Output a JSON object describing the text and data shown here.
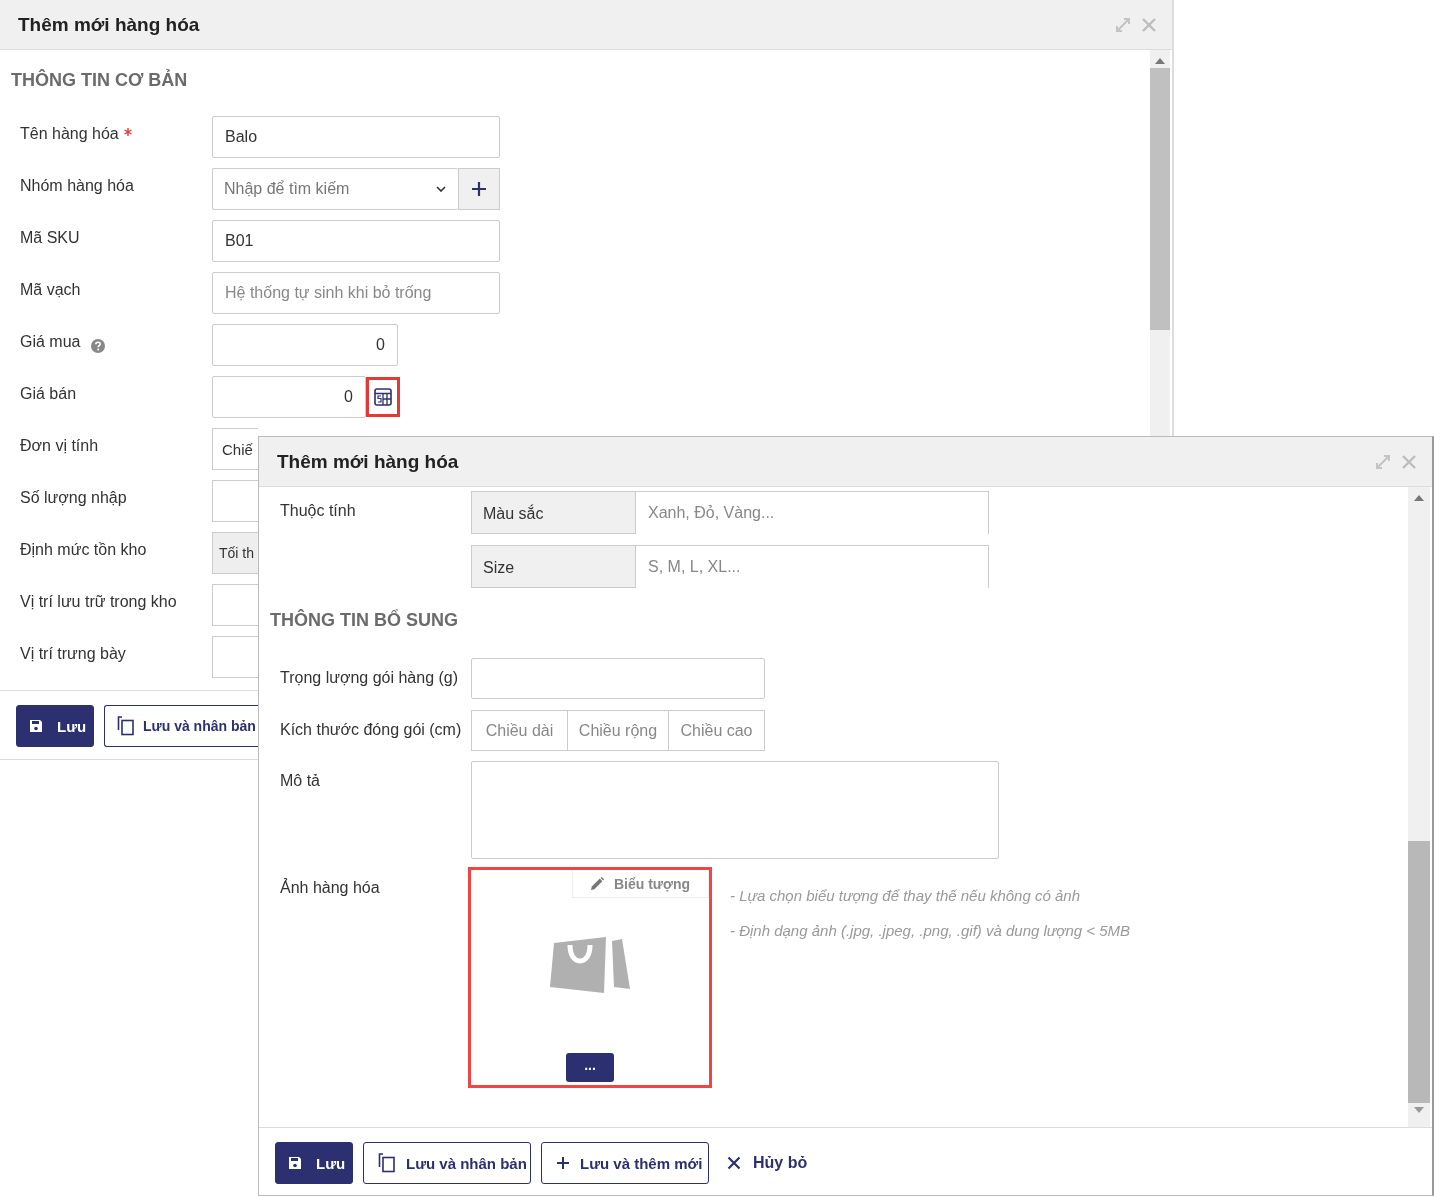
{
  "back_dialog": {
    "title": "Thêm mới hàng hóa",
    "section_title": "THÔNG TIN CƠ BẢN",
    "fields": [
      {
        "label": "Tên hàng hóa",
        "kind": "text",
        "value": "Balo",
        "required": true,
        "help": false
      },
      {
        "label": "Nhóm hàng hóa",
        "kind": "select-add",
        "placeholder": "Nhập để tìm kiếm",
        "required": false,
        "help": false
      },
      {
        "label": "Mã SKU",
        "kind": "text",
        "value": "B01",
        "required": false,
        "help": false
      },
      {
        "label": "Mã vạch",
        "kind": "text",
        "placeholder": "Hệ thống tự sinh khi bỏ trống",
        "required": false,
        "help": false
      },
      {
        "label": "Giá mua",
        "kind": "number",
        "value": "0",
        "required": false,
        "help": true
      },
      {
        "label": "Giá bán",
        "kind": "number-calc",
        "value": "0",
        "highlighted": true,
        "required": false,
        "help": false
      },
      {
        "label": "Đơn vị tính",
        "kind": "text",
        "value": "Chiế",
        "required": false,
        "help": false
      },
      {
        "label": "Số lượng nhập",
        "kind": "text",
        "required": false,
        "help": false
      },
      {
        "label": "Định mức tồn kho",
        "kind": "readonly",
        "value": "Tối th",
        "required": false,
        "help": false
      },
      {
        "label": "Vị trí lưu trữ trong kho",
        "kind": "text",
        "required": false,
        "help": false
      },
      {
        "label": "Vị trí trưng bày",
        "kind": "text",
        "required": false,
        "help": false
      }
    ],
    "buttons": [
      {
        "label": "Lưu",
        "kind": "save"
      },
      {
        "label": "Lưu và nhân bản",
        "kind": "duplicate"
      }
    ]
  },
  "front_dialog": {
    "title": "Thêm mới hàng hóa",
    "attributes_label": "Thuộc tính",
    "attributes": [
      {
        "name": "Màu sắc",
        "placeholder": "Xanh, Đỏ, Vàng..."
      },
      {
        "name": "Size",
        "placeholder": "S, M, L, XL..."
      }
    ],
    "section_title": "THÔNG TIN BỔ SUNG",
    "fields": [
      {
        "label": "Trọng lượng gói hàng (g)",
        "kind": "text"
      },
      {
        "label": "Kích thước đóng gói (cm)",
        "kind": "dimensions",
        "placeholders": [
          "Chiều dài",
          "Chiều rộng",
          "Chiều cao"
        ]
      },
      {
        "label": "Mô tả",
        "kind": "textarea"
      }
    ],
    "image": {
      "label": "Ảnh hàng hóa",
      "icon_button": "Biểu tượng",
      "browse_button": "...",
      "highlighted": true,
      "hints": [
        "- Lựa chọn biểu tượng để thay thế nếu không có ảnh",
        "- Định dạng ảnh (.jpg, .jpeg, .png, .gif) và dung lượng < 5MB"
      ]
    },
    "buttons": [
      {
        "label": "Lưu",
        "kind": "save"
      },
      {
        "label": "Lưu và nhân bản",
        "kind": "duplicate"
      },
      {
        "label": "Lưu và thêm mới",
        "kind": "add"
      },
      {
        "label": "Hủy bỏ",
        "kind": "cancel"
      }
    ]
  }
}
